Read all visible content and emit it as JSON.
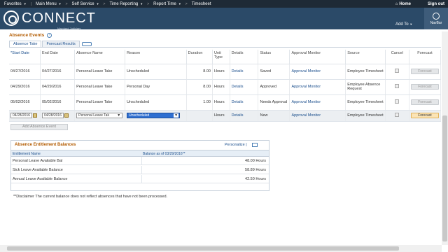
{
  "menubar": {
    "items": [
      {
        "label": "Favorites"
      },
      {
        "label": "Main Menu"
      },
      {
        "label": "Self Service"
      },
      {
        "label": "Time Reporting"
      },
      {
        "label": "Report Time"
      },
      {
        "label": "Timesheet"
      }
    ],
    "home": "Home",
    "signout": "Sign out"
  },
  "header": {
    "logo": "CONNECT",
    "logo_sub": "Maryland Judiciary",
    "add_to": "Add To",
    "navbar": "NavBar"
  },
  "absence": {
    "title": "Absence Events",
    "tabs": [
      {
        "label": "Absence Take"
      },
      {
        "label": "Forecast Results"
      }
    ],
    "columns": [
      "*Start Date",
      "End Date",
      "Absence Name",
      "Reason",
      "Duration",
      "Unit Type",
      "Details",
      "Status",
      "Approval Monitor",
      "Source",
      "Cancel",
      "Forecast"
    ],
    "rows": [
      {
        "start": "04/27/2016",
        "end": "04/27/2016",
        "name": "Personal Leave Take",
        "reason": "Unscheduled",
        "duration": "8.00",
        "unit": "Hours",
        "details": "Details",
        "status": "Saved",
        "monitor": "Approval Monitor",
        "source": "Employee Timesheet",
        "forecast": "Forecast"
      },
      {
        "start": "04/29/2016",
        "end": "04/29/2016",
        "name": "Personal Leave Take",
        "reason": "Personal Day",
        "duration": "8.00",
        "unit": "Hours",
        "details": "Details",
        "status": "Approved",
        "monitor": "Approval Monitor",
        "source": "Employee Absence Request",
        "forecast": "Forecast"
      },
      {
        "start": "05/02/2016",
        "end": "05/02/2016",
        "name": "Personal Leave Take",
        "reason": "Unscheduled",
        "duration": "1.00",
        "unit": "Hours",
        "details": "Details",
        "status": "Needs Approval",
        "monitor": "Approval Monitor",
        "source": "Employee Timesheet",
        "forecast": "Forecast"
      }
    ],
    "edit_row": {
      "start": "04/28/2016",
      "end": "04/28/2016",
      "name": "Personal Leave Tak",
      "reason": "Unscheduled",
      "unit": "Hours",
      "details": "Details",
      "status": "New",
      "monitor": "Approval Monitor",
      "source": "Employee Timesheet",
      "forecast": "Forecast"
    },
    "add_button": "Add Absence Event"
  },
  "balances": {
    "title": "Absence Entitlement Balances",
    "personalize": "Personalize |",
    "col_name": "Entitlement Name",
    "col_balance": "Balance as of 03/29/2016**",
    "rows": [
      {
        "name": "Personal Leave Available Bal",
        "value": "48.00 Hours"
      },
      {
        "name": "Sick Leave Available Balance",
        "value": "58.89 Hours"
      },
      {
        "name": "Annual Leave Available Balance",
        "value": "42.50 Hours"
      }
    ]
  },
  "disclaimer": "**Disclaimer  The current balance does not reflect absences that have not been processed."
}
